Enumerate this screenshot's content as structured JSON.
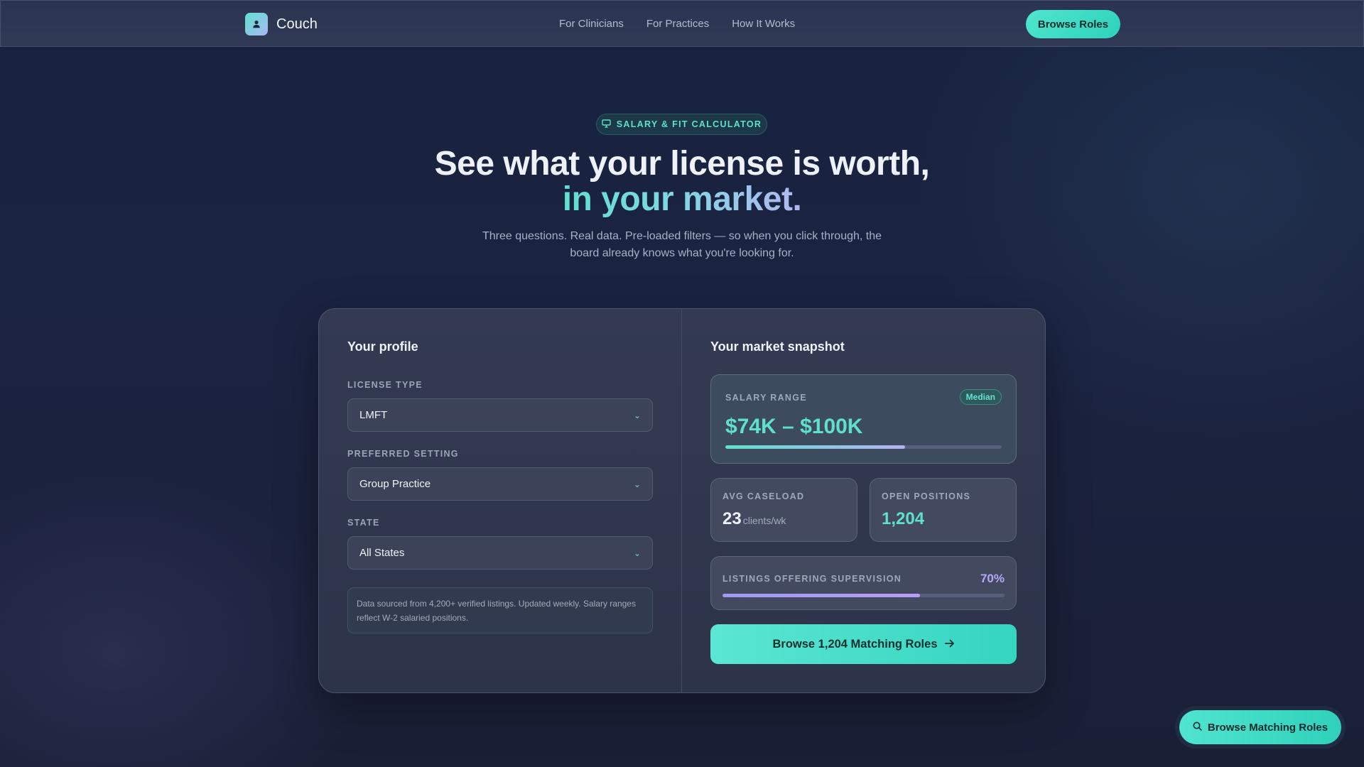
{
  "nav": {
    "brand": "Couch",
    "links": [
      "For Clinicians",
      "For Practices",
      "How It Works"
    ],
    "cta": "Browse Roles"
  },
  "hero": {
    "badge": "SALARY & FIT CALCULATOR",
    "headline": "See what your license is worth,",
    "headline_accent": "in your market.",
    "subtitle": "Three questions. Real data. Pre-loaded filters — so when you click through, the board already knows what you're looking for."
  },
  "profile": {
    "title": "Your profile",
    "license_label": "LICENSE TYPE",
    "license_value": "LMFT",
    "setting_label": "PREFERRED SETTING",
    "setting_value": "Group Practice",
    "state_label": "STATE",
    "state_value": "All States",
    "note": "Data sourced from 4,200+ verified listings. Updated weekly. Salary ranges reflect W-2 salaried positions."
  },
  "snapshot": {
    "title": "Your market snapshot",
    "salary_label": "SALARY RANGE",
    "salary_badge": "Median",
    "salary_value": "$74K – $100K",
    "salary_bar_fraction": 0.65,
    "caseload_label": "AVG CASELOAD",
    "caseload_value": "23",
    "caseload_unit": "clients/wk",
    "positions_label": "OPEN POSITIONS",
    "positions_value": "1,204",
    "supervision_label": "LISTINGS OFFERING SUPERVISION",
    "supervision_value": "70%",
    "supervision_fraction": 0.7,
    "cta": "Browse 1,204 Matching Roles"
  },
  "floating_cta": "Browse Matching Roles",
  "colors": {
    "accent": "#5fe0cd",
    "accent_secondary": "#b5a8f5",
    "background": "#1b2340"
  }
}
